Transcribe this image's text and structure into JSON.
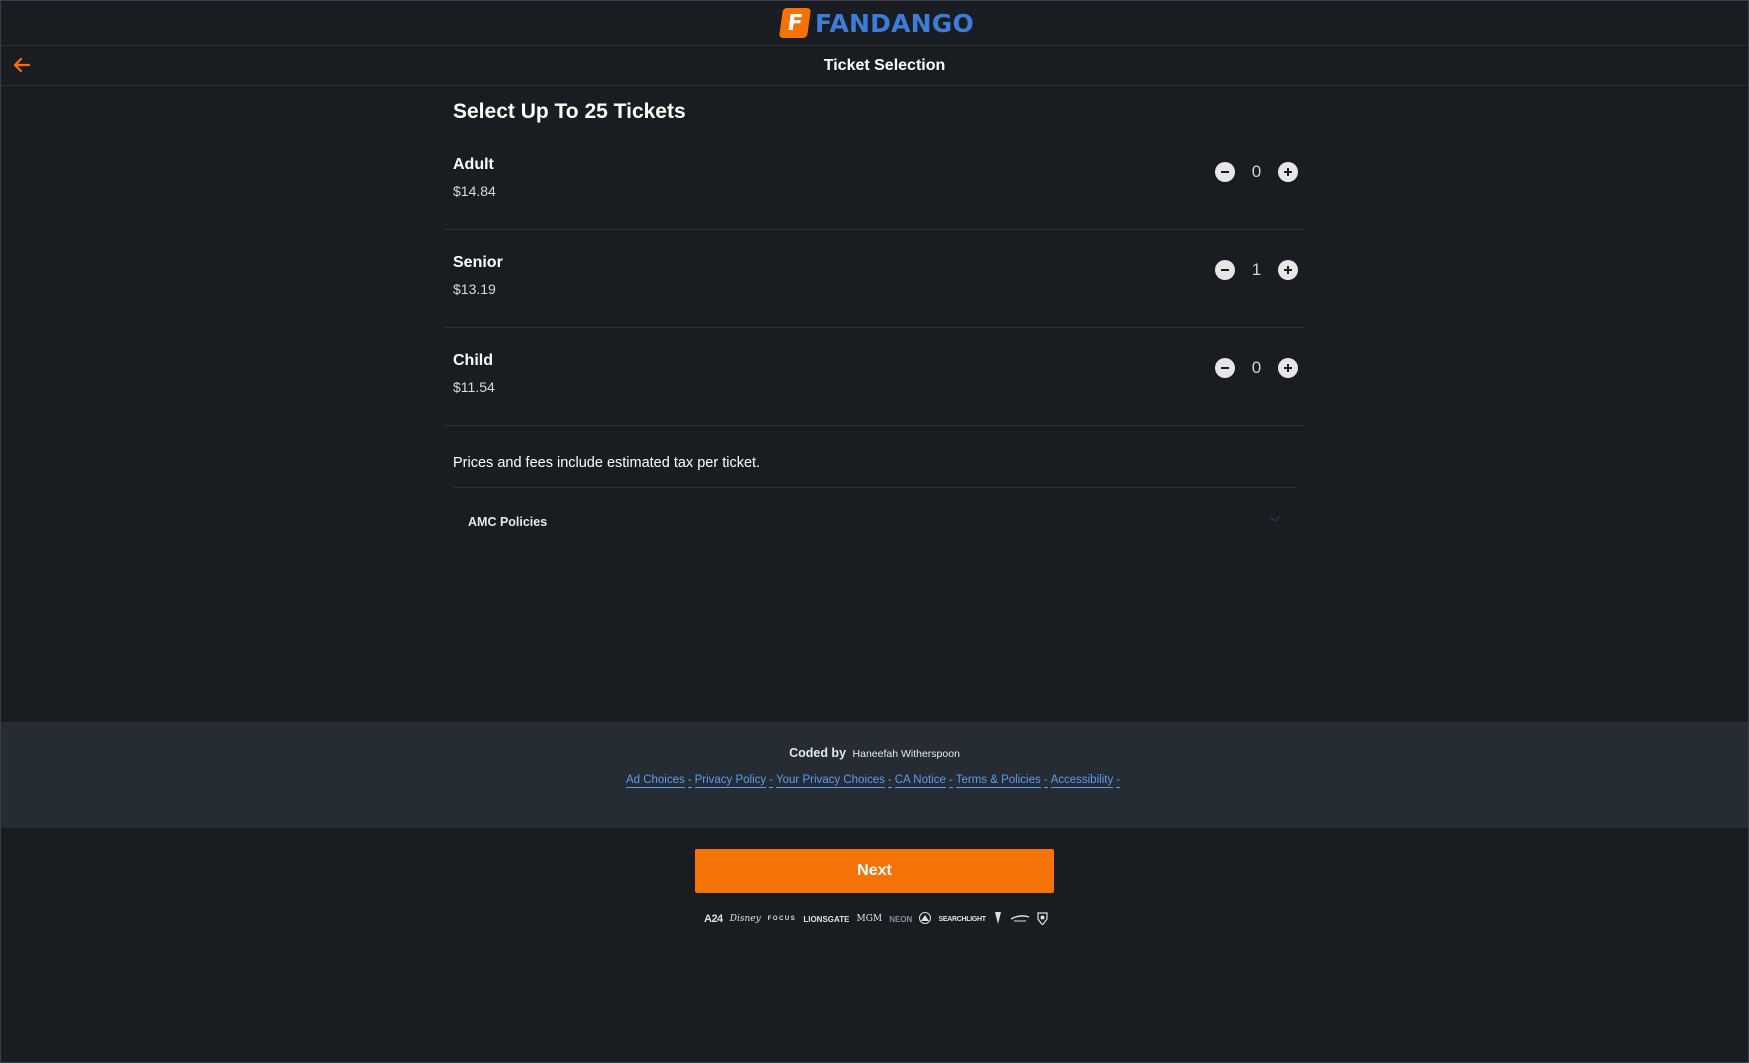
{
  "header": {
    "logo_text": "FANDANGO",
    "logo_mark": "F",
    "page_title": "Ticket Selection",
    "back_icon": "arrow-left-icon"
  },
  "main": {
    "heading": "Select Up To 25 Tickets",
    "tickets": [
      {
        "name": "Adult",
        "price": "$14.84",
        "count": "0"
      },
      {
        "name": "Senior",
        "price": "$13.19",
        "count": "1"
      },
      {
        "name": "Child",
        "price": "$11.54",
        "count": "0"
      }
    ],
    "note": "Prices and fees include estimated tax per ticket.",
    "policies_label": "AMC Policies"
  },
  "footer": {
    "coded_by_label": "Coded by",
    "coded_by_name": "Haneefah Witherspoon",
    "links": [
      "Ad Choices",
      "Privacy Policy",
      "Your Privacy Choices",
      "CA Notice",
      "Terms & Policies",
      "Accessibility"
    ],
    "link_separator": "-"
  },
  "actions": {
    "next_label": "Next"
  },
  "studios": [
    "A24",
    "Disney",
    "FOCUS",
    "LIONSGATE",
    "MGM",
    "NEON",
    "Paramount",
    "SEARCHLIGHT",
    "Sony",
    "Universal",
    "Warner Bros"
  ],
  "colors": {
    "accent": "#f57206",
    "brand_blue": "#3d7dd8",
    "link": "#5a9cf0",
    "background": "#191d21",
    "footer_bg": "#262c33"
  }
}
